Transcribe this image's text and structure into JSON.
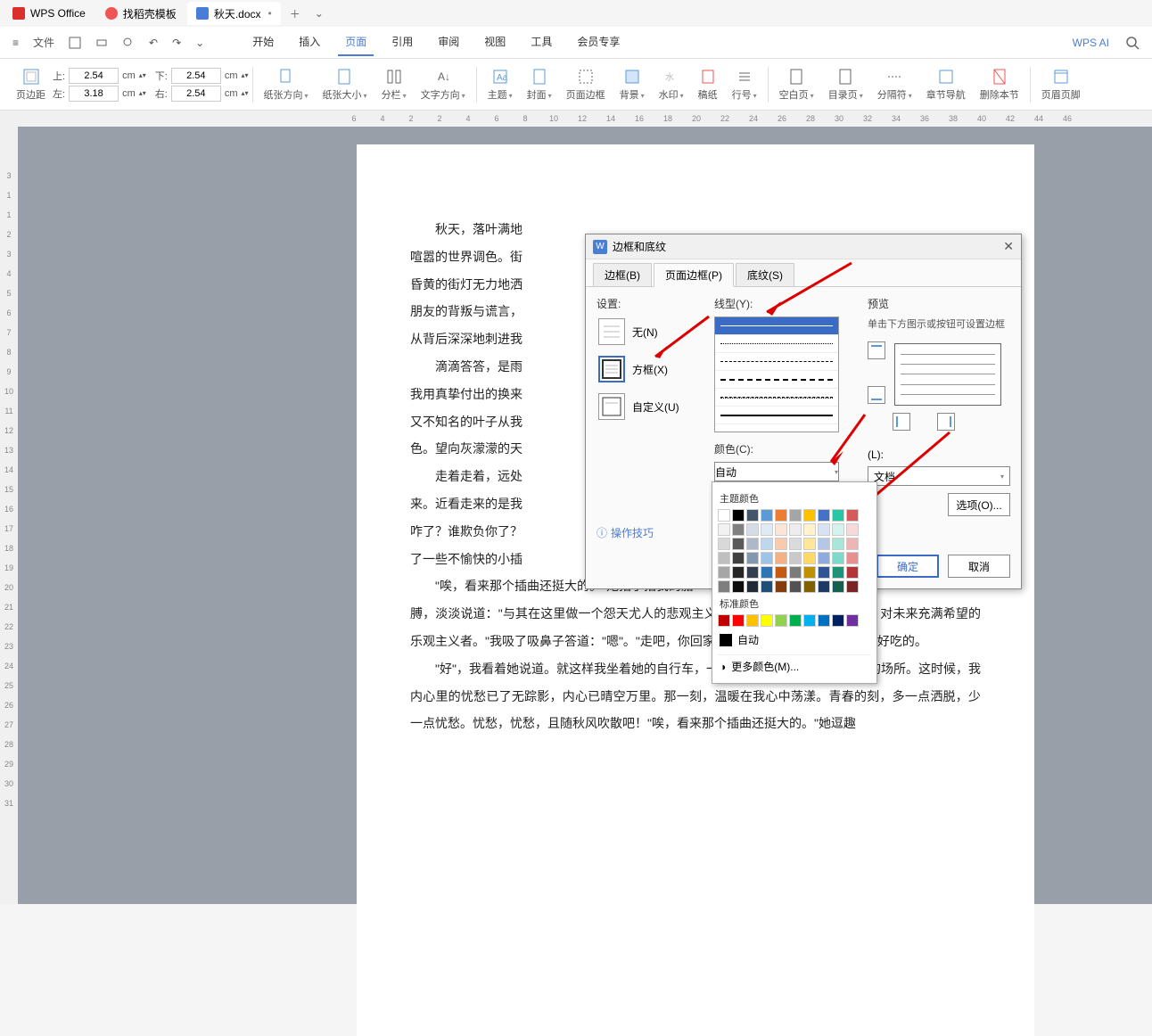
{
  "tabs": {
    "wps": "WPS Office",
    "template": "找稻壳模板",
    "doc": "秋天.docx"
  },
  "menu": {
    "file": "文件",
    "tabs": [
      "开始",
      "插入",
      "页面",
      "引用",
      "审阅",
      "视图",
      "工具",
      "会员专享"
    ],
    "active": "页面",
    "ai": "WPS AI"
  },
  "ribbon": {
    "margins": "页边距",
    "top": "上:",
    "top_val": "2.54",
    "top_unit": "cm",
    "bottom": "下:",
    "bottom_val": "2.54",
    "bottom_unit": "cm",
    "left": "左:",
    "left_val": "3.18",
    "left_unit": "cm",
    "right": "右:",
    "right_val": "2.54",
    "right_unit": "cm",
    "orientation": "纸张方向",
    "size": "纸张大小",
    "columns": "分栏",
    "textdir": "文字方向",
    "theme": "主题",
    "cover": "封面",
    "pageborder": "页面边框",
    "background": "背景",
    "watermark": "水印",
    "gao": "稿纸",
    "lineno": "行号",
    "blank": "空白页",
    "toc": "目录页",
    "break": "分隔符",
    "chapnav": "章节导航",
    "delsec": "删除本节",
    "headerfooter": "页眉页脚"
  },
  "ruler_h": [
    "6",
    "4",
    "2",
    "2",
    "4",
    "6",
    "8",
    "10",
    "12",
    "14",
    "16",
    "18",
    "20",
    "22",
    "24",
    "26",
    "28",
    "30",
    "32",
    "34",
    "36",
    "38",
    "40",
    "42",
    "44",
    "46"
  ],
  "ruler_v": [
    "3",
    "1",
    "1",
    "2",
    "3",
    "4",
    "5",
    "6",
    "7",
    "8",
    "9",
    "10",
    "11",
    "12",
    "13",
    "14",
    "15",
    "16",
    "17",
    "18",
    "19",
    "20",
    "21",
    "22",
    "23",
    "24",
    "25",
    "26",
    "27",
    "28",
    "29",
    "30",
    "31"
  ],
  "doc": {
    "p1": "秋天，落叶满地",
    "p2": "喧嚣的世界调色。街",
    "p3": "昏黄的街灯无力地洒",
    "p4": "朋友的背叛与谎言，",
    "p5": "从背后深深地刺进我",
    "p6": "滴滴答答，是雨",
    "p7": "我用真挚付出的换来",
    "p8": "又不知名的叶子从我",
    "p9": "色。望向灰濛濛的天",
    "p10": "走着走着，远处",
    "p11": "来。近看走来的是我",
    "p12": "咋了？谁欺负你了？",
    "p13": "了一些不愉快的小插",
    "p14": "\"唉，看来那个插曲还挺大的。\"她指了指我的胳",
    "p15": "膊，淡淡说道：\"与其在这里做一个怨天尤人的悲观主义者，还不如做一个仰望天空，对未来充满希望的乐观主义者。\"我吸了吸鼻子答道：\"嗯\"。\"走吧，你回家先洗个澡，洗完后我带你去吃好吃的。",
    "p16": "\"好\"，我看着她说道。就这样我坐着她的自行车，一路冒着雨，渐渐离开这失意的场所。这时候，我内心里的忧愁已了无踪影，内心已晴空万里。那一刻，温暖在我心中荡漾。青春的刻，多一点洒脱，少一点忧愁。忧愁，忧愁，且随秋风吹散吧！\"唉，看来那个插曲还挺大的。\"她逗趣"
  },
  "dialog": {
    "title": "边框和底纹",
    "tab_border": "边框(B)",
    "tab_page": "页面边框(P)",
    "tab_shading": "底纹(S)",
    "setting": "设置:",
    "none": "无(N)",
    "box": "方框(X)",
    "custom": "自定义(U)",
    "linetype": "线型(Y):",
    "color": "颜色(C):",
    "auto": "自动",
    "preview": "预览",
    "preview_hint": "单击下方图示或按钮可设置边框",
    "applyto": "(L):",
    "applyto_val": "文档",
    "options": "选项(O)...",
    "ok": "确定",
    "cancel": "取消",
    "tips": "操作技巧"
  },
  "colorpopup": {
    "theme": "主题颜色",
    "standard": "标准颜色",
    "auto": "自动",
    "more": "更多颜色(M)...",
    "theme_row1": [
      "#ffffff",
      "#000000",
      "#44546a",
      "#5b9bd5",
      "#ed7d31",
      "#a5a5a5",
      "#ffc000",
      "#4472c4",
      "#28c6a4",
      "#d55b5b"
    ],
    "theme_shades": [
      [
        "#f2f2f2",
        "#808080",
        "#d6dce5",
        "#deebf7",
        "#fbe5d6",
        "#ededed",
        "#fff2cc",
        "#d9e2f3",
        "#d3f3ec",
        "#f6dada"
      ],
      [
        "#d9d9d9",
        "#595959",
        "#adb9ca",
        "#bdd7ee",
        "#f8cbad",
        "#dbdbdb",
        "#ffe699",
        "#b4c7e7",
        "#a7e7da",
        "#eeb5b5"
      ],
      [
        "#bfbfbf",
        "#404040",
        "#8497b0",
        "#9dc3e6",
        "#f4b183",
        "#c9c9c9",
        "#ffd966",
        "#8faadc",
        "#7bdbc8",
        "#e69090"
      ],
      [
        "#a6a6a6",
        "#262626",
        "#333f50",
        "#2e75b6",
        "#c55a11",
        "#7b7b7b",
        "#bf9000",
        "#2f5597",
        "#1f9378",
        "#b33636"
      ],
      [
        "#7f7f7f",
        "#0d0d0d",
        "#222a35",
        "#1f4e79",
        "#843c0c",
        "#525252",
        "#806000",
        "#203864",
        "#145f4e",
        "#7a2424"
      ]
    ],
    "standard_colors": [
      "#c00000",
      "#ff0000",
      "#ffc000",
      "#ffff00",
      "#92d050",
      "#00b050",
      "#00b0f0",
      "#0070c0",
      "#002060",
      "#7030a0"
    ]
  }
}
